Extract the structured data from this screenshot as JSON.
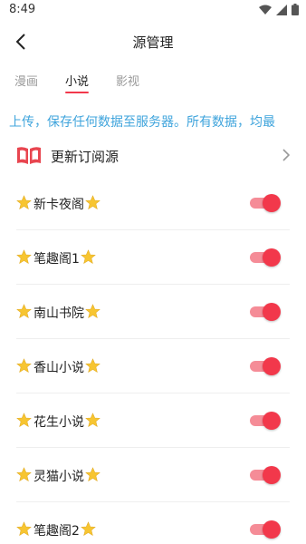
{
  "status_bar": {
    "time": "8:49"
  },
  "nav": {
    "title": "源管理"
  },
  "tabs": [
    {
      "label": "漫画",
      "active": false
    },
    {
      "label": "小说",
      "active": true
    },
    {
      "label": "影视",
      "active": false
    }
  ],
  "notice": "上传，保存任何数据至服务器。所有数据，均最",
  "update_source": {
    "label": "更新订阅源"
  },
  "sources": [
    {
      "name": "新卡夜阁",
      "enabled": true
    },
    {
      "name": "笔趣阁1",
      "enabled": true
    },
    {
      "name": "南山书院",
      "enabled": true
    },
    {
      "name": "香山小说",
      "enabled": true
    },
    {
      "name": "花生小说",
      "enabled": true
    },
    {
      "name": "灵猫小说",
      "enabled": true
    },
    {
      "name": "笔趣阁2",
      "enabled": true
    }
  ],
  "colors": {
    "accent": "#f2384b",
    "toggle_track": "#f58c97",
    "notice": "#3fa4dc"
  }
}
